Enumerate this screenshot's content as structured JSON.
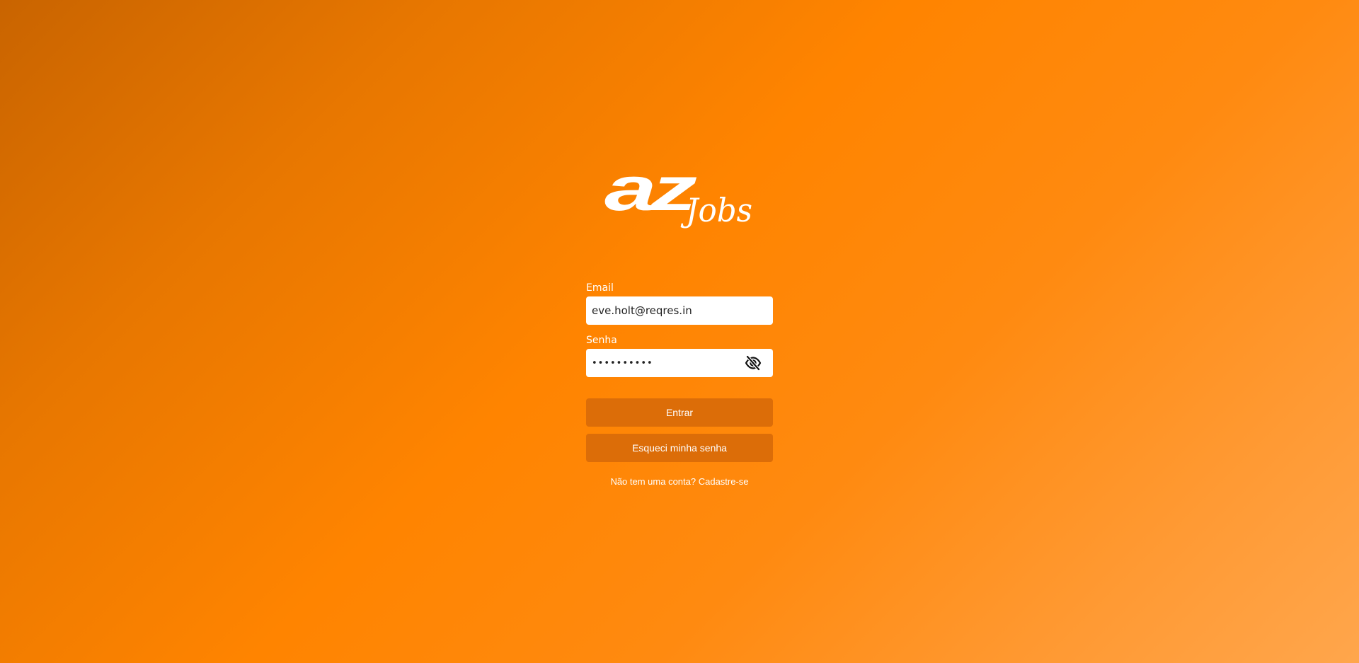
{
  "brand": {
    "logo_text_az": "az",
    "logo_text_jobs": "Jobs"
  },
  "login": {
    "email_label": "Email",
    "email_value": "eve.holt@reqres.in",
    "password_label": "Senha",
    "password_value": "cityslicka",
    "password_toggle_icon": "eye-slash-icon",
    "login_button": "Entrar",
    "forgot_button": "Esqueci minha senha",
    "signup_link": "Não tem uma conta? Cadastre-se"
  },
  "colors": {
    "background_start": "#c96400",
    "background_mid": "#ff8400",
    "background_end": "#ffa64c",
    "button_bg": "#dc6d08",
    "text": "#ffffff"
  }
}
